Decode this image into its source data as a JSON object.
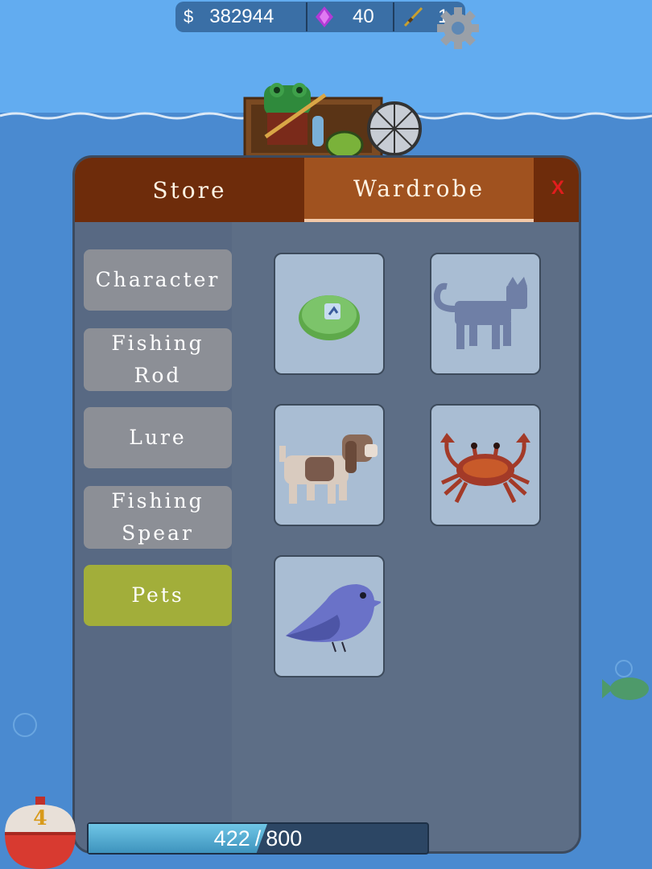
{
  "hud": {
    "money_symbol": "$",
    "money": "382944",
    "gems": "40",
    "rods": "1"
  },
  "tabs": [
    {
      "label": "Store",
      "active": false
    },
    {
      "label": "Wardrobe",
      "active": true
    }
  ],
  "close_label": "X",
  "categories": [
    {
      "lines": [
        "Character"
      ],
      "active": false
    },
    {
      "lines": [
        "Fishing",
        "Rod"
      ],
      "active": false
    },
    {
      "lines": [
        "Lure"
      ],
      "active": false
    },
    {
      "lines": [
        "Fishing",
        "Spear"
      ],
      "active": false
    },
    {
      "lines": [
        "Pets"
      ],
      "active": true
    }
  ],
  "pets": [
    "slime-pet-icon",
    "cat-pet-icon",
    "dog-pet-icon",
    "crab-pet-icon",
    "bird-pet-icon"
  ],
  "xp": {
    "current": "422",
    "separator": "/",
    "max": "800",
    "fraction": 0.5275
  },
  "level": "4",
  "colors": {
    "tab_bar": "#6e2c0b",
    "tab_active": "#a0521f",
    "category_button": "#8c8f96",
    "category_active": "#a2ae3a",
    "slot": "#a9bdd3",
    "close_x": "#e11d1d"
  }
}
